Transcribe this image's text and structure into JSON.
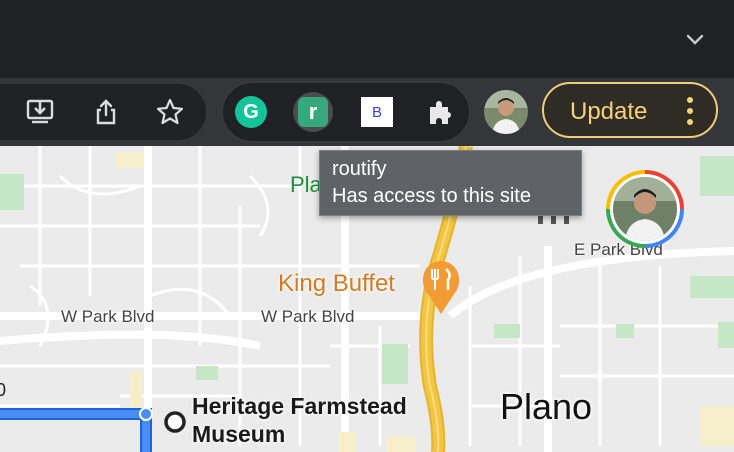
{
  "browser": {
    "tab_strip": {
      "chevron_icon": "chevron-down-icon"
    },
    "toolbar": {
      "icons": [
        "download-icon",
        "share-icon",
        "bookmark-star-icon"
      ],
      "extensions": [
        {
          "name": "grammarly",
          "glyph": "G",
          "color": "#15c39a"
        },
        {
          "name": "routify",
          "glyph": "r",
          "color": "#37a77d"
        },
        {
          "name": "b-extension",
          "glyph": "B",
          "color": "#3946b5"
        }
      ],
      "puzzle_icon": "puzzle-icon",
      "update_label": "Update",
      "update_color": "#f6d37a"
    },
    "tooltip": {
      "title": "routify",
      "subtitle": "Has access to this site"
    }
  },
  "map": {
    "labels": {
      "park_partial": "Pla",
      "poi_name": "King Buffet",
      "street_e_park": "E Park Blvd",
      "street_w_park_left": "W Park Blvd",
      "street_w_park_center": "W Park Blvd",
      "city": "Plano",
      "museum_line1": "Heritage Farmstead",
      "museum_line2": "Museum"
    },
    "colors": {
      "highway": "#f4c542",
      "route": "#4a8df6",
      "park": "#c5e7c5",
      "poi": "#d17b24"
    }
  }
}
